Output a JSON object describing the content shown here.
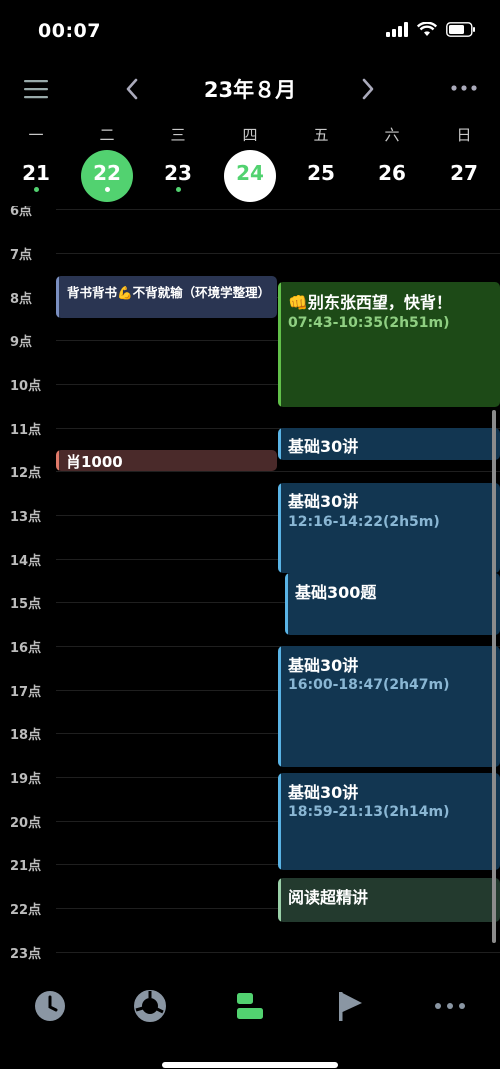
{
  "status_bar": {
    "time": "00:07"
  },
  "header": {
    "title": "23年８月"
  },
  "weekdays": [
    "一",
    "二",
    "三",
    "四",
    "五",
    "六",
    "日"
  ],
  "days": [
    "21",
    "22",
    "23",
    "24",
    "25",
    "26",
    "27"
  ],
  "hours": [
    "6点",
    "7点",
    "8点",
    "9点",
    "10点",
    "11点",
    "12点",
    "13点",
    "14点",
    "15点",
    "16点",
    "17点",
    "18点",
    "19点",
    "20点",
    "21点",
    "22点",
    "23点"
  ],
  "events": [
    {
      "title": "背书背书💪不背就输（环境学整理）",
      "color": "#2a3552"
    },
    {
      "title": "👊别东张西望，快背！",
      "time": "07:43-10:35(2h51m)",
      "color": "#1d4a17"
    },
    {
      "title": "基础30讲",
      "color": "#123651"
    },
    {
      "title": "肖1000",
      "color": "#4a2a2a"
    },
    {
      "title": "基础30讲",
      "time": "12:16-14:22(2h5m)",
      "color": "#123651"
    },
    {
      "title": "基础300题",
      "color": "#123651"
    },
    {
      "title": "基础30讲",
      "time": "16:00-18:47(2h47m)",
      "color": "#123651"
    },
    {
      "title": "基础30讲",
      "time": "18:59-21:13(2h14m)",
      "color": "#123651"
    },
    {
      "title": "阅读超精讲",
      "color": "#233a2e"
    }
  ],
  "colors": {
    "accent": "#52d270",
    "blue_bar": "#5ab4e6",
    "green_bar": "#62c04a",
    "slate_bar": "#7a8fc0",
    "red_bar": "#e07a6a",
    "mint_bar": "#9ad0a8"
  },
  "bottom_nav": [
    "clock-icon",
    "pie-chart-icon",
    "timeline-icon",
    "flag-icon",
    "more-icon"
  ]
}
